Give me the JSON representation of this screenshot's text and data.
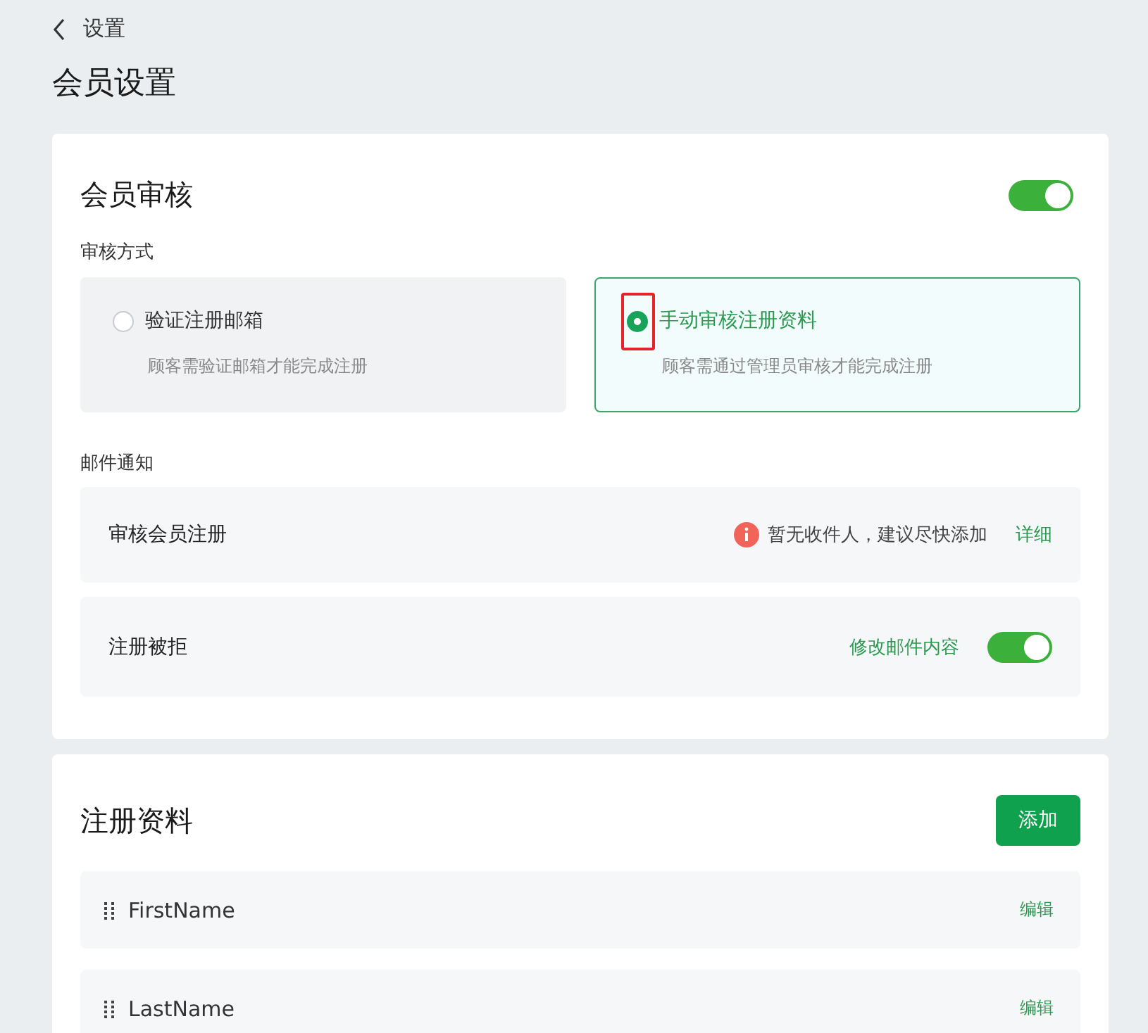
{
  "back": {
    "label": "设置"
  },
  "title": "会员设置",
  "review": {
    "title": "会员审核",
    "on": true,
    "method_label": "审核方式",
    "options": [
      {
        "title": "验证注册邮箱",
        "description": "顾客需验证邮箱才能完成注册",
        "selected": false,
        "highlighted": false
      },
      {
        "title": "手动审核注册资料",
        "description": "顾客需通过管理员审核才能完成注册",
        "selected": true,
        "highlighted": true
      }
    ],
    "notify_label": "邮件通知",
    "notifications": [
      {
        "kind": "warning",
        "label": "审核会员注册",
        "message": "暂无收件人，建议尽快添加",
        "link": "详细"
      },
      {
        "kind": "toggle",
        "label": "注册被拒",
        "link": "修改邮件内容",
        "on": true
      }
    ]
  },
  "fields": {
    "title": "注册资料",
    "add_button": "添加",
    "items": [
      {
        "name": "FirstName",
        "action": "编辑"
      },
      {
        "name": "LastName",
        "action": "编辑"
      }
    ]
  }
}
